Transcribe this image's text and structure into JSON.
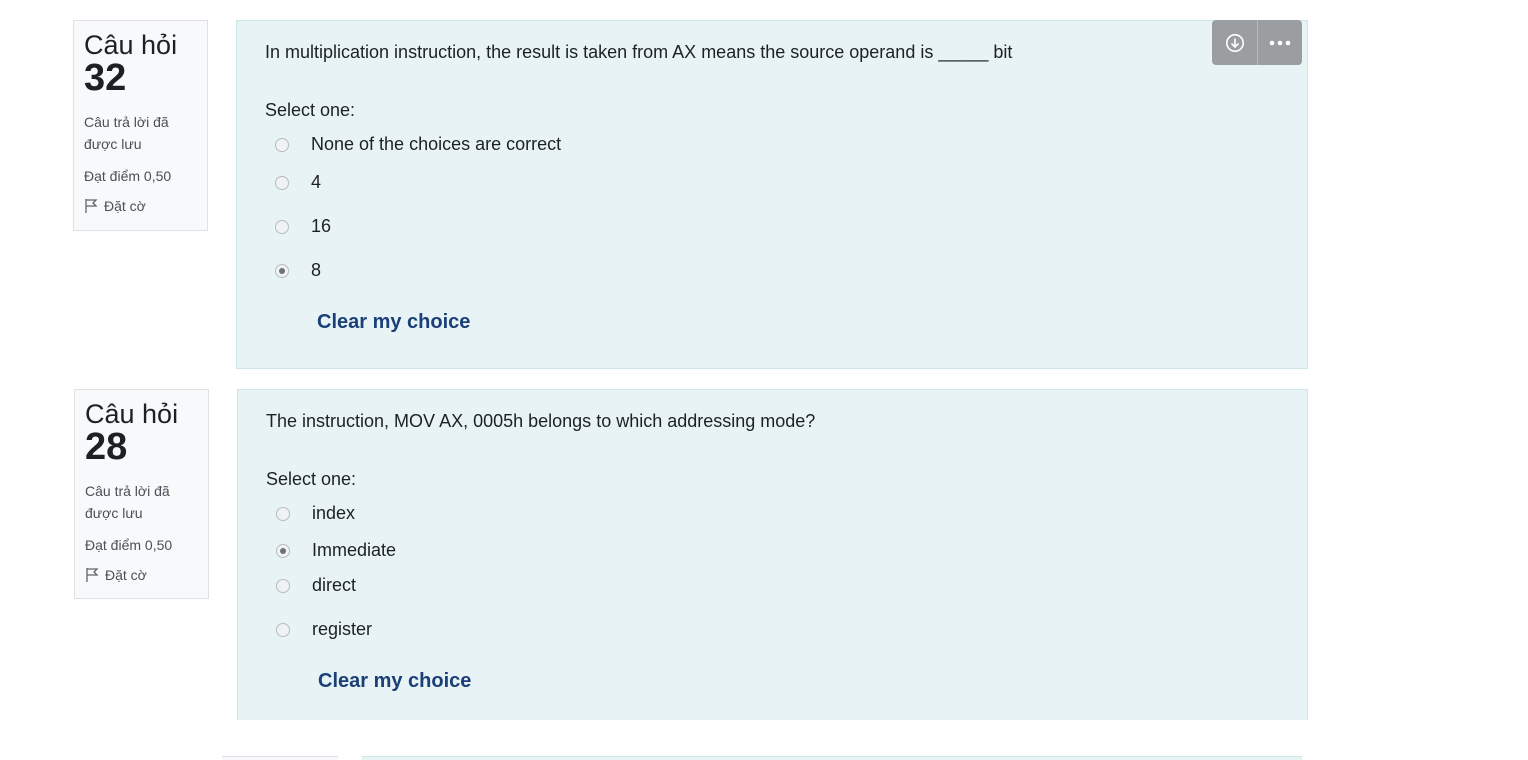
{
  "questions": [
    {
      "label": "Câu hỏi",
      "number": "32",
      "state": "Câu trả lời đã được lưu",
      "grade": "Đạt điểm 0,50",
      "flag_label": "Đặt cờ",
      "text": "In multiplication instruction, the result is taken from AX means the source operand is _____ bit",
      "prompt": "Select one:",
      "options": [
        {
          "label": "None of the choices are correct",
          "selected": false
        },
        {
          "label": "4",
          "selected": false
        },
        {
          "label": "16",
          "selected": false
        },
        {
          "label": "8",
          "selected": true
        }
      ],
      "clear_label": "Clear my choice"
    },
    {
      "label": "Câu hỏi",
      "number": "28",
      "state": "Câu trả lời đã được lưu",
      "grade": "Đạt điểm 0,50",
      "flag_label": "Đặt cờ",
      "text": "The instruction, MOV AX, 0005h belongs to which addressing mode?",
      "prompt": "Select one:",
      "options": [
        {
          "label": "index",
          "selected": false
        },
        {
          "label": "Immediate",
          "selected": true
        },
        {
          "label": "direct",
          "selected": false
        },
        {
          "label": "register",
          "selected": false
        }
      ],
      "clear_label": "Clear my choice"
    }
  ],
  "toolbar": {
    "icons": [
      "download-icon",
      "more-icon"
    ]
  }
}
